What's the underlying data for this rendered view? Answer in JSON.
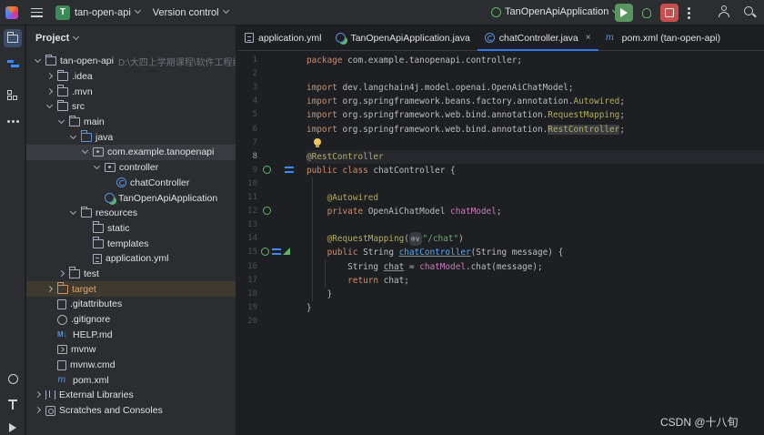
{
  "titlebar": {
    "project_badge": "T",
    "project_name": "tan-open-api",
    "vcs": "Version control",
    "run_config": "TanOpenApiApplication"
  },
  "project_panel": {
    "title": "Project",
    "tree": [
      {
        "label": "tan-open-api",
        "suffix": "D:\\大四上学期课程\\软件工程综合",
        "icon": "dir",
        "arrow": "open",
        "level": 0
      },
      {
        "label": ".idea",
        "icon": "dir",
        "arrow": "closed",
        "level": 1
      },
      {
        "label": ".mvn",
        "icon": "dir",
        "arrow": "closed",
        "level": 1
      },
      {
        "label": "src",
        "icon": "dir",
        "arrow": "open",
        "level": 1
      },
      {
        "label": "main",
        "icon": "dir",
        "arrow": "open",
        "level": 2
      },
      {
        "label": "java",
        "icon": "src",
        "arrow": "open",
        "level": 3
      },
      {
        "label": "com.example.tanopenapi",
        "icon": "pkg",
        "arrow": "open",
        "level": 4,
        "state": "selected"
      },
      {
        "label": "controller",
        "icon": "pkg",
        "arrow": "open",
        "level": 5
      },
      {
        "label": "chatController",
        "icon": "cls",
        "arrow": "none",
        "level": 6
      },
      {
        "label": "TanOpenApiApplication",
        "icon": "app",
        "arrow": "none",
        "level": 5
      },
      {
        "label": "resources",
        "icon": "dir",
        "arrow": "open",
        "level": 3
      },
      {
        "label": "static",
        "icon": "dir",
        "arrow": "none",
        "level": 4
      },
      {
        "label": "templates",
        "icon": "dir",
        "arrow": "none",
        "level": 4
      },
      {
        "label": "application.yml",
        "icon": "yml",
        "arrow": "none",
        "level": 4
      },
      {
        "label": "test",
        "icon": "dir",
        "arrow": "closed",
        "level": 2
      },
      {
        "label": "target",
        "icon": "tgt",
        "arrow": "closed",
        "level": 1,
        "state": "target"
      },
      {
        "label": ".gitattributes",
        "icon": "txt",
        "arrow": "none",
        "level": 1
      },
      {
        "label": ".gitignore",
        "icon": "git",
        "arrow": "none",
        "level": 1
      },
      {
        "label": "HELP.md",
        "icon": "md",
        "arrow": "none",
        "level": 1
      },
      {
        "label": "mvnw",
        "icon": "term",
        "arrow": "none",
        "level": 1
      },
      {
        "label": "mvnw.cmd",
        "icon": "txt",
        "arrow": "none",
        "level": 1
      },
      {
        "label": "pom.xml",
        "icon": "mvn",
        "arrow": "none",
        "level": 1
      },
      {
        "label": "External Libraries",
        "icon": "lib",
        "arrow": "closed",
        "level": 0
      },
      {
        "label": "Scratches and Consoles",
        "icon": "scr",
        "arrow": "closed",
        "level": 0
      }
    ]
  },
  "tabs": [
    {
      "label": "application.yml",
      "icon": "yml",
      "active": false
    },
    {
      "label": "TanOpenApiApplication.java",
      "icon": "app",
      "active": false
    },
    {
      "label": "chatController.java",
      "icon": "cls",
      "active": true,
      "close": "×"
    },
    {
      "label": "pom.xml (tan-open-api)",
      "icon": "mvn",
      "active": false
    }
  ],
  "editor": {
    "current_line": 8,
    "lines": [
      [
        [
          "kw",
          "package "
        ],
        [
          "",
          "com.example.tanopenapi.controller;"
        ]
      ],
      [],
      [
        [
          "kw",
          "import "
        ],
        [
          "",
          "dev.langchain4j.model.openai.OpenAiChatModel;"
        ]
      ],
      [
        [
          "kw",
          "import "
        ],
        [
          "",
          "org.springframework.beans.factory.annotation."
        ],
        [
          "ann",
          "Autowired"
        ],
        [
          "",
          ";"
        ]
      ],
      [
        [
          "kw",
          "import "
        ],
        [
          "",
          "org.springframework.web.bind.annotation."
        ],
        [
          "ann",
          "RequestMapping"
        ],
        [
          "",
          ";"
        ]
      ],
      [
        [
          "kw",
          "import "
        ],
        [
          "",
          "org.springframework.web.bind.annotation."
        ],
        [
          "annhl",
          "RestController"
        ],
        [
          "",
          ";"
        ]
      ],
      [],
      [
        [
          "ann",
          "@RestController"
        ]
      ],
      [
        [
          "kw",
          "public class "
        ],
        [
          "",
          "chatController {"
        ]
      ],
      [],
      [
        [
          "",
          "    "
        ],
        [
          "ann",
          "@Autowired"
        ]
      ],
      [
        [
          "",
          "    "
        ],
        [
          "kw",
          "private "
        ],
        [
          "",
          "OpenAiChatModel "
        ],
        [
          "fld",
          "chatModel"
        ],
        [
          "",
          ";"
        ]
      ],
      [],
      [
        [
          "",
          "    "
        ],
        [
          "ann",
          "@RequestMapping"
        ],
        [
          "",
          "("
        ],
        [
          "badge",
          "⊕∨"
        ],
        [
          "str",
          "\"/chat\""
        ],
        [
          "",
          ")"
        ]
      ],
      [
        [
          "",
          "    "
        ],
        [
          "kw",
          "public "
        ],
        [
          "",
          "String "
        ],
        [
          "fnul",
          "chatController"
        ],
        [
          "",
          "(String message) {"
        ]
      ],
      [
        [
          "",
          "        String "
        ],
        [
          "ul",
          "chat"
        ],
        [
          "",
          " = "
        ],
        [
          "fld",
          "chatModel"
        ],
        [
          "",
          ".chat(message);"
        ]
      ],
      [
        [
          "",
          "        "
        ],
        [
          "kw",
          "return "
        ],
        [
          "",
          "chat;"
        ]
      ],
      [
        [
          "",
          "    }"
        ]
      ],
      [
        [
          "",
          "}"
        ]
      ],
      []
    ]
  },
  "watermark": "CSDN @十八旬"
}
